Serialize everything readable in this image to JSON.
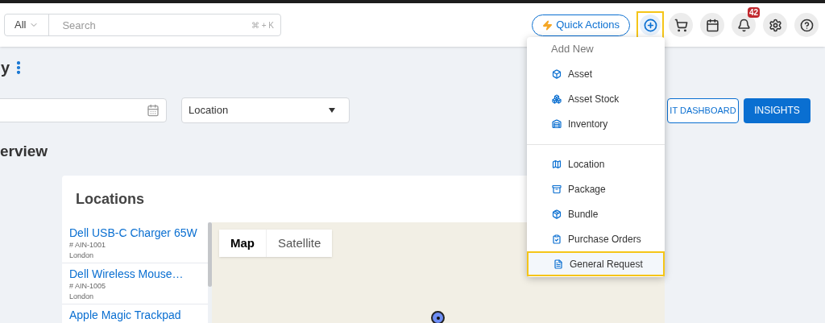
{
  "header": {
    "search": {
      "scope": "All",
      "placeholder": "Search",
      "shortcut": "⌘ + K"
    },
    "quick_actions": "Quick Actions",
    "add_button": {
      "highlighted": true
    },
    "notifications": {
      "count": "42"
    }
  },
  "page": {
    "title": "y",
    "filters": {
      "location": "Location"
    },
    "buttons": [
      "IT DASHBOARD",
      "INSIGHTS"
    ],
    "section_title": "erview"
  },
  "locations_card": {
    "title": "Locations",
    "items": [
      {
        "name": "Dell USB-C Charger 65W",
        "code": "# AIN-1001",
        "place": "London"
      },
      {
        "name": "Dell Wireless Mouse…",
        "code": "# AIN-1005",
        "place": "London"
      },
      {
        "name": "Apple Magic Trackpad"
      }
    ],
    "map_tabs": [
      {
        "label": "Map",
        "selected": true
      },
      {
        "label": "Satellite",
        "selected": false
      }
    ]
  },
  "add_menu": {
    "heading": "Add New",
    "sections": [
      {
        "items": [
          {
            "kind": "asset",
            "label": "Asset",
            "highlighted": false
          },
          {
            "kind": "stock",
            "label": "Asset Stock",
            "highlighted": false
          },
          {
            "kind": "inventory",
            "label": "Inventory",
            "highlighted": false
          }
        ]
      },
      {
        "items": [
          {
            "kind": "location",
            "label": "Location",
            "highlighted": false
          },
          {
            "kind": "package",
            "label": "Package",
            "highlighted": false
          },
          {
            "kind": "bundle",
            "label": "Bundle",
            "highlighted": false
          },
          {
            "kind": "purchase",
            "label": "Purchase Orders",
            "highlighted": false
          },
          {
            "kind": "request",
            "label": "General Request",
            "highlighted": true
          }
        ]
      }
    ]
  }
}
